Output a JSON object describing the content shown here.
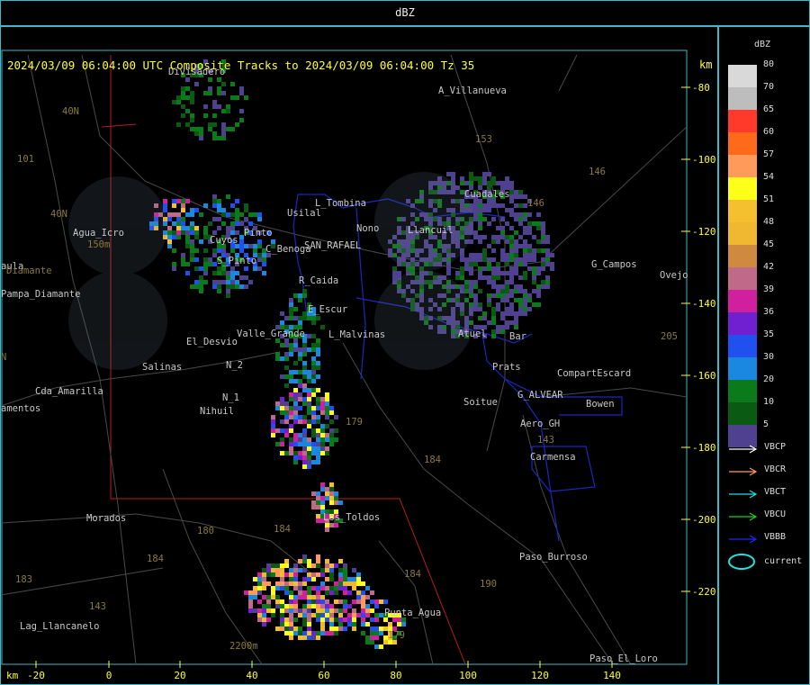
{
  "window_title": "dBZ",
  "header": {
    "text": "2024/03/09 06:04:00 UTC Composite Tracks to 2024/03/09 06:04:00 Tz 35",
    "km_unit": "km"
  },
  "axes": {
    "x_unit": "km",
    "x_ticks": [
      "-20",
      "0",
      "20",
      "40",
      "60",
      "80",
      "100",
      "120",
      "140"
    ],
    "y_ticks": [
      "-80",
      "-100",
      "-120",
      "-140",
      "-160",
      "-180",
      "-200",
      "-220"
    ]
  },
  "places": [
    {
      "name": "Divisadero"
    },
    {
      "name": "A_Villanueva"
    },
    {
      "name": "Usilal"
    },
    {
      "name": "L_Tombina"
    },
    {
      "name": "Nono"
    },
    {
      "name": "Llancuil"
    },
    {
      "name": "Cuadales"
    },
    {
      "name": "Agua_Icro"
    },
    {
      "name": "Cuyos"
    },
    {
      "name": "Pinto"
    },
    {
      "name": "Pampa_Diamante"
    },
    {
      "name": "C_Benoga"
    },
    {
      "name": "SAN_RAFAEL"
    },
    {
      "name": "G_Campos"
    },
    {
      "name": "S_Pinto"
    },
    {
      "name": "R_Caida"
    },
    {
      "name": "Ovejo"
    },
    {
      "name": "E_Escur"
    },
    {
      "name": "Valle_Grande"
    },
    {
      "name": "L_Malvinas"
    },
    {
      "name": "Atuel"
    },
    {
      "name": "Bar"
    },
    {
      "name": "El_Desvio"
    },
    {
      "name": "Salinas"
    },
    {
      "name": "N_2"
    },
    {
      "name": "Prats"
    },
    {
      "name": "CompartEscard"
    },
    {
      "name": "Cda_Amarilla"
    },
    {
      "name": "N_1"
    },
    {
      "name": "G_ALVEAR"
    },
    {
      "name": "Soitue"
    },
    {
      "name": "Bowen"
    },
    {
      "name": "amentos"
    },
    {
      "name": "Nihuil"
    },
    {
      "name": "Aero_GH"
    },
    {
      "name": "Carmensa"
    },
    {
      "name": "Morados"
    },
    {
      "name": "Los_Toldos"
    },
    {
      "name": "Paso_Burroso"
    },
    {
      "name": "Lag_Llancanelo"
    },
    {
      "name": "Punta_Agua"
    },
    {
      "name": "Paso_El_Loro"
    },
    {
      "name": "aula"
    }
  ],
  "road_labels": [
    "101",
    "40N",
    "40N",
    "153",
    "146",
    "146",
    "179",
    "184",
    "184",
    "143",
    "180",
    "190",
    "184",
    "183",
    "184",
    "179",
    "143",
    "205",
    "150m",
    "2200m",
    "N",
    "Diamante"
  ],
  "legend": {
    "title": "dBZ",
    "scale": [
      {
        "label": "80",
        "color": "#d9d9d9"
      },
      {
        "label": "70",
        "color": "#bdbdbd"
      },
      {
        "label": "65",
        "color": "#ff3a2a"
      },
      {
        "label": "60",
        "color": "#ff6a1a"
      },
      {
        "label": "57",
        "color": "#ff9a5a"
      },
      {
        "label": "54",
        "color": "#ffff1a"
      },
      {
        "label": "51",
        "color": "#f5c030"
      },
      {
        "label": "48",
        "color": "#f0b830"
      },
      {
        "label": "45",
        "color": "#d08a40"
      },
      {
        "label": "42",
        "color": "#c06a8a"
      },
      {
        "label": "39",
        "color": "#d020a0"
      },
      {
        "label": "36",
        "color": "#7020d0"
      },
      {
        "label": "35",
        "color": "#2050f0"
      },
      {
        "label": "30",
        "color": "#1a88e0"
      },
      {
        "label": "20",
        "color": "#0a7a1a"
      },
      {
        "label": "10",
        "color": "#0a5a14"
      },
      {
        "label": "5",
        "color": "#504090"
      }
    ],
    "tracks": [
      {
        "label": "VBCP",
        "color": "#ffffff"
      },
      {
        "label": "VBCR",
        "color": "#ff9a5a"
      },
      {
        "label": "VBCT",
        "color": "#22e0e0"
      },
      {
        "label": "VBCU",
        "color": "#22d022"
      },
      {
        "label": "VBBB",
        "color": "#1a28ff"
      }
    ],
    "current_label": "current",
    "current_color": "#22e0e0"
  }
}
